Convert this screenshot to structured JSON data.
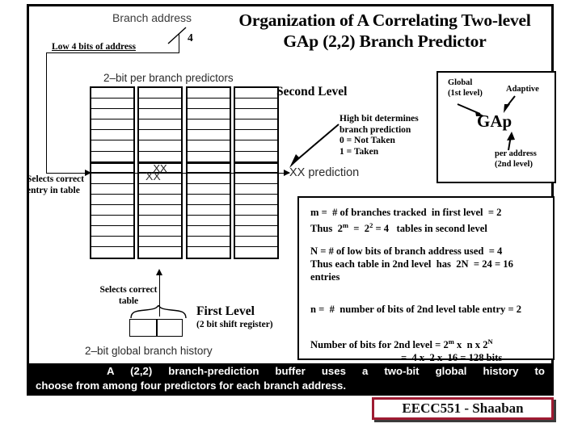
{
  "title": "Organization of A Correlating Two-level GAp (2,2) Branch Predictor",
  "diagram": {
    "branch_address_label": "Branch address",
    "low_bits_label": "Low 4 bits of address",
    "bit_count": "4",
    "predictors_label": "2–bit per branch predictors",
    "selects_entry_label": "Selects correct entry in table",
    "selects_table_label": "Selects correct table",
    "xx_cell": "XX",
    "xx_mid_label": "XX",
    "second_level_heading": "Second Level",
    "high_bit_note": "High bit determines branch prediction 0 = Not Taken 1 = Taken",
    "high_bit_note_lines": [
      "High bit determines",
      "branch prediction",
      "0  =  Not Taken",
      "1 =  Taken"
    ],
    "xx_prediction_label": "XX prediction",
    "first_level_title": "First Level",
    "first_level_sub": "(2 bit shift register)",
    "global_history_label": "2–bit global branch history",
    "table_count": 4,
    "rows_per_table": 16,
    "selected_row_index": 7
  },
  "gap_box": {
    "global_label": "Global\n(1st level)",
    "global_line1": "Global",
    "global_line2": "(1st level)",
    "adaptive_label": "Adaptive",
    "acronym": "GAp",
    "per_address_line1": "per address",
    "per_address_line2": "(2nd level)"
  },
  "formula_box": {
    "lines": [
      "m =  # of branches tracked  in first level  = 2",
      "Thus  2^m  =  2^2 = 4   tables in second level",
      "",
      "N = # of low bits of branch address used  = 4",
      "Thus each table in 2nd level  has  2N  = 24 = 16",
      "entries",
      "",
      "n =  #  number of bits of 2nd level table entry = 2",
      "",
      "Number of bits for 2nd level = 2^m x  n x 2^N",
      "=  4 x  2 x  16 = 128 bits"
    ],
    "l1": "m =  # of branches tracked  in first level  = 2",
    "l2a": "Thus  2",
    "l2b": "m",
    "l2c": "  =  2",
    "l2d": "2",
    "l2e": " = 4   tables in second level",
    "l3": "N = # of low bits of branch address used  = 4",
    "l4": "Thus each table in 2nd level  has  2N  = 24 = 16",
    "l5": "entries",
    "l6": "n =  #  number of bits of 2nd level table entry = 2",
    "l7a": "Number of bits for 2nd level = 2",
    "l7b": "m",
    "l7c": " x  n x 2",
    "l7d": "N",
    "l8": "=  4 x  2 x  16 = 128 bits"
  },
  "banner": {
    "line1": "A  (2,2)  branch-prediction  buffer  uses  a  two-bit  global  history  to",
    "line2": "choose from among four predictors for each branch address."
  },
  "footer": {
    "badge_text": "EECC551 - Shaaban"
  },
  "colors": {
    "badge_border": "#9e1b32",
    "banner_bg": "#000000",
    "ink": "#000000"
  }
}
